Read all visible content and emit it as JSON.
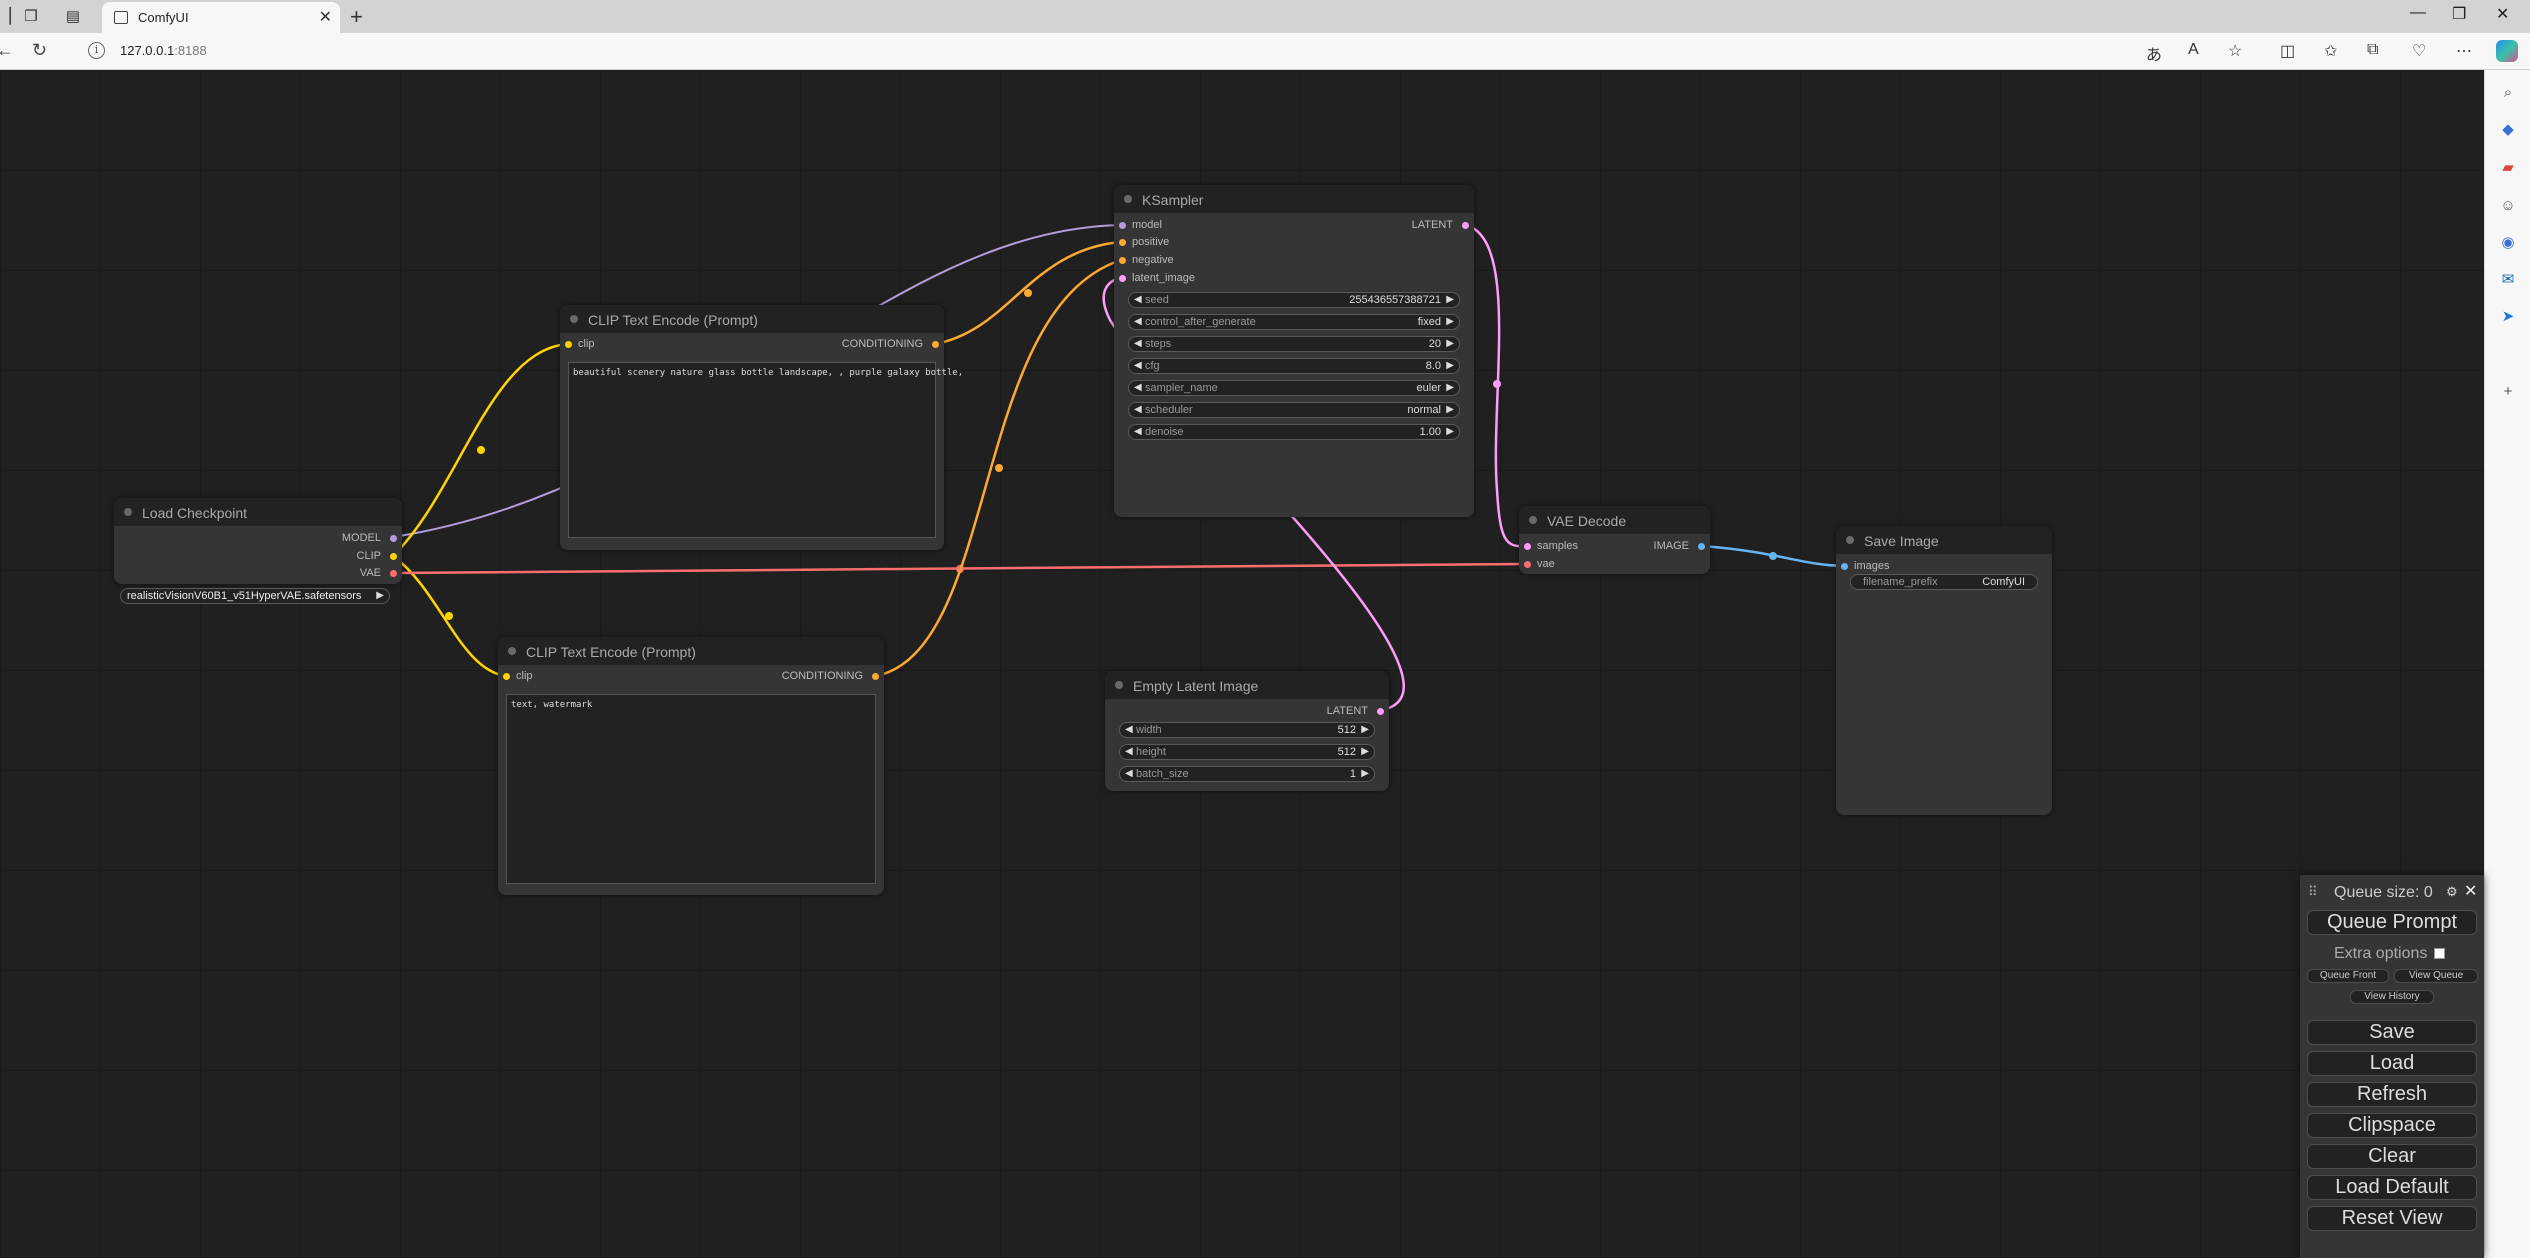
{
  "browser": {
    "tab_title": "ComfyUI",
    "url_host": "127.0.0.1",
    "url_port": ":8188"
  },
  "nodes": {
    "ksampler": {
      "title": "KSampler",
      "inputs": [
        "model",
        "positive",
        "negative",
        "latent_image"
      ],
      "output": "LATENT",
      "widgets": [
        {
          "label": "seed",
          "value": "255436557388721"
        },
        {
          "label": "control_after_generate",
          "value": "fixed"
        },
        {
          "label": "steps",
          "value": "20"
        },
        {
          "label": "cfg",
          "value": "8.0"
        },
        {
          "label": "sampler_name",
          "value": "euler"
        },
        {
          "label": "scheduler",
          "value": "normal"
        },
        {
          "label": "denoise",
          "value": "1.00"
        }
      ]
    },
    "clip_pos": {
      "title": "CLIP Text Encode (Prompt)",
      "input": "clip",
      "output": "CONDITIONING",
      "text": "beautiful scenery nature glass bottle landscape, , purple galaxy bottle,"
    },
    "clip_neg": {
      "title": "CLIP Text Encode (Prompt)",
      "input": "clip",
      "output": "CONDITIONING",
      "text": "text, watermark"
    },
    "checkpoint": {
      "title": "Load Checkpoint",
      "outputs": [
        "MODEL",
        "CLIP",
        "VAE"
      ],
      "ckpt_name": "realisticVisionV60B1_v51HyperVAE.safetensors"
    },
    "vae_decode": {
      "title": "VAE Decode",
      "inputs": [
        "samples",
        "vae"
      ],
      "output": "IMAGE"
    },
    "save_image": {
      "title": "Save Image",
      "input": "images",
      "widget_label": "filename_prefix",
      "widget_value": "ComfyUI"
    },
    "empty_latent": {
      "title": "Empty Latent Image",
      "output": "LATENT",
      "widgets": [
        {
          "label": "width",
          "value": "512"
        },
        {
          "label": "height",
          "value": "512"
        },
        {
          "label": "batch_size",
          "value": "1"
        }
      ]
    }
  },
  "menu": {
    "queue_size": "Queue size: 0",
    "queue_prompt": "Queue Prompt",
    "extra_options": "Extra options",
    "queue_front": "Queue Front",
    "view_queue": "View Queue",
    "view_history": "View History",
    "save": "Save",
    "load": "Load",
    "refresh": "Refresh",
    "clipspace": "Clipspace",
    "clear": "Clear",
    "load_default": "Load Default",
    "reset_view": "Reset View"
  },
  "colors": {
    "model": "#b39ddb",
    "clip": "#ffd500",
    "vae": "#ff6e6e",
    "conditioning": "#ffa931",
    "latent": "#ff9cf9",
    "image": "#64b5f6"
  }
}
